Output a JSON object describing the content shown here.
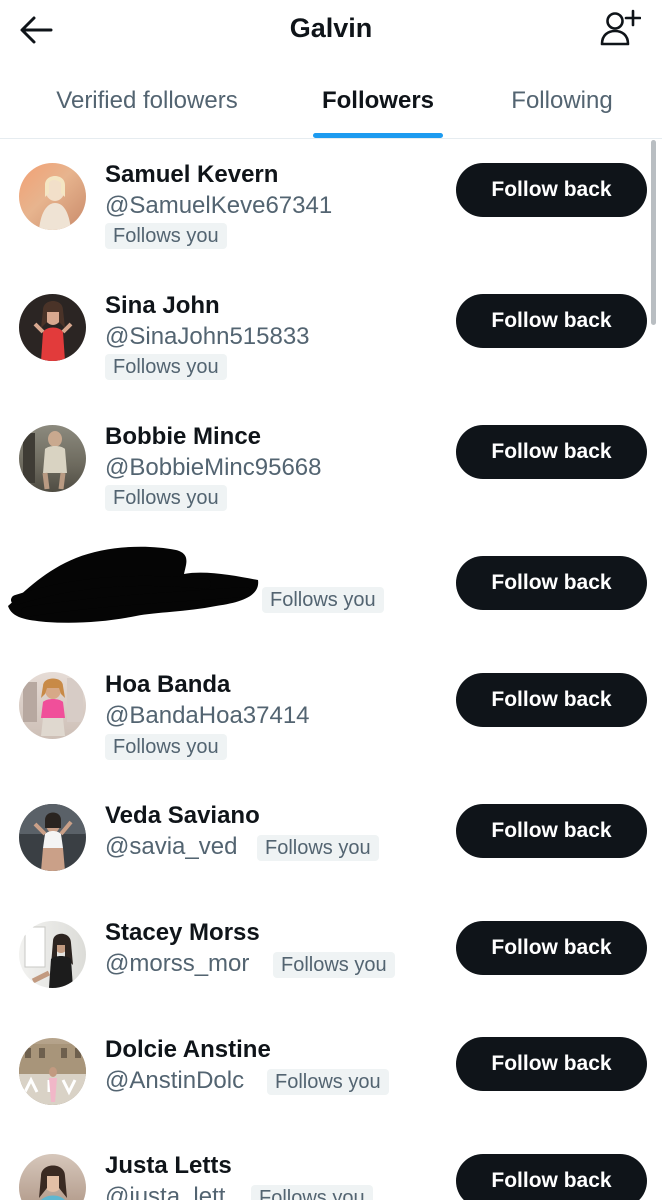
{
  "header": {
    "title": "Galvin",
    "back_icon": "arrow-left-icon",
    "add_icon": "add-user-icon"
  },
  "tabs": [
    {
      "label": "Verified followers",
      "active": false
    },
    {
      "label": "Followers",
      "active": true
    },
    {
      "label": "Following",
      "active": false
    }
  ],
  "colors": {
    "accent": "#1d9bf0",
    "button_bg": "#0f1419",
    "secondary_text": "#536471",
    "badge_bg": "#eff3f4"
  },
  "follow_back_label": "Follow back",
  "follows_you_label": "Follows you",
  "users": [
    {
      "name": "Samuel Kevern",
      "handle": "@SamuelKeve67341",
      "badge": "Follows you",
      "button": "Follow back"
    },
    {
      "name": "Sina John",
      "handle": "@SinaJohn515833",
      "badge": "Follows you",
      "button": "Follow back"
    },
    {
      "name": "Bobbie Mince",
      "handle": "@BobbieMinc95668",
      "badge": "Follows you",
      "button": "Follow back"
    },
    {
      "name": "",
      "handle": "",
      "badge": "Follows you",
      "button": "Follow back",
      "redacted": true
    },
    {
      "name": "Hoa Banda",
      "handle": "@BandaHoa37414",
      "badge": "Follows you",
      "button": "Follow back"
    },
    {
      "name": "Veda Saviano",
      "handle": "@savia_ved",
      "badge": "Follows you",
      "button": "Follow back"
    },
    {
      "name": "Stacey Morss",
      "handle": "@morss_mor",
      "badge": "Follows you",
      "button": "Follow back"
    },
    {
      "name": "Dolcie Anstine",
      "handle": "@AnstinDolc",
      "badge": "Follows you",
      "button": "Follow back"
    },
    {
      "name": "Justa Letts",
      "handle": "@justa_lett",
      "badge": "Follows you",
      "button": "Follow back"
    }
  ]
}
